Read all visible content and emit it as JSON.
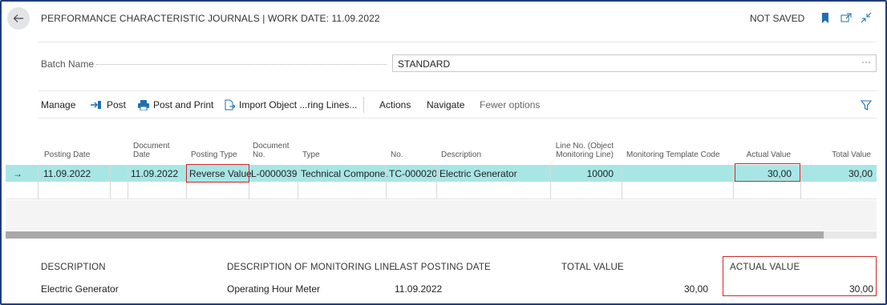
{
  "header": {
    "title": "PERFORMANCE CHARACTERISTIC JOURNALS | WORK DATE: 11.09.2022",
    "status": "NOT SAVED",
    "accent_color": "#1f6fb5"
  },
  "batch": {
    "label": "Batch Name",
    "value": "STANDARD",
    "more": "···"
  },
  "actions": {
    "manage": "Manage",
    "post": "Post",
    "post_and_print": "Post and Print",
    "import": "Import Object ...ring Lines...",
    "actions": "Actions",
    "navigate": "Navigate",
    "fewer_options": "Fewer options"
  },
  "grid": {
    "columns": {
      "posting_date": "Posting Date",
      "document_date": "Document Date",
      "posting_type": "Posting Type",
      "document_no": "Document No.",
      "type": "Type",
      "no": "No.",
      "description": "Description",
      "line_no": "Line No. (Object Monitoring Line)",
      "monitoring_template_code": "Monitoring Template Code",
      "actual_value": "Actual Value",
      "total_value": "Total Value"
    },
    "rows": [
      {
        "indicator": "→",
        "posting_date": "11.09.2022",
        "document_date": "11.09.2022",
        "posting_type": "Reverse Value",
        "document_no": "L-0000039",
        "type": "Technical Compone...",
        "no": "TC-000020",
        "description": "Electric Generator",
        "line_no": "10000",
        "monitoring_template_code": "",
        "actual_value": "30,00",
        "total_value": "30,00"
      }
    ],
    "selected_color": "#a8e6e6",
    "highlight_color": "#cc2a2a"
  },
  "factbox": {
    "description_label": "DESCRIPTION",
    "description_value": "Electric Generator",
    "monitoring_line_label": "DESCRIPTION OF MONITORING LINE",
    "monitoring_line_value": "Operating Hour Meter",
    "last_posting_label": "LAST POSTING DATE",
    "last_posting_value": "11.09.2022",
    "total_value_label": "TOTAL VALUE",
    "total_value_value": "30,00",
    "actual_value_label": "ACTUAL VALUE",
    "actual_value_value": "30,00"
  }
}
